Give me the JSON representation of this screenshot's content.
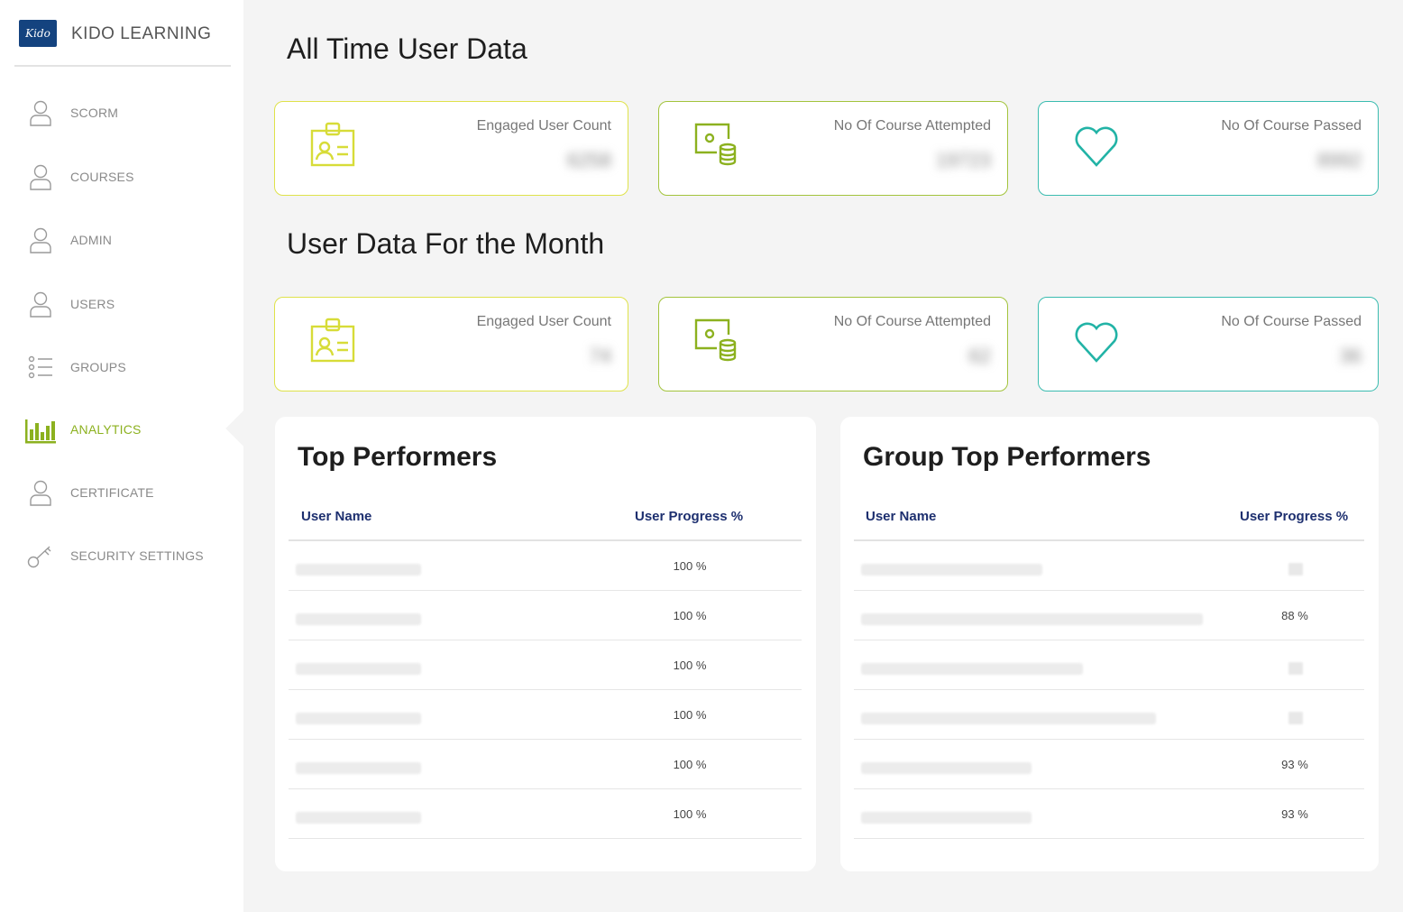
{
  "brand": {
    "logo_text": "Kido",
    "name": "KIDO LEARNING"
  },
  "sidebar": {
    "items": [
      {
        "label": "SCORM",
        "icon": "user-icon"
      },
      {
        "label": "COURSES",
        "icon": "user-icon"
      },
      {
        "label": "ADMIN",
        "icon": "user-icon"
      },
      {
        "label": "USERS",
        "icon": "user-icon"
      },
      {
        "label": "GROUPS",
        "icon": "list-icon"
      },
      {
        "label": "ANALYTICS",
        "icon": "bar-chart-icon",
        "active": true
      },
      {
        "label": "CERTIFICATE",
        "icon": "user-icon"
      },
      {
        "label": "SECURITY SETTINGS",
        "icon": "key-icon"
      }
    ]
  },
  "all_time": {
    "title": "All Time User Data",
    "cards": [
      {
        "label": "Engaged User Count",
        "value": "6258",
        "icon": "id-badge-icon"
      },
      {
        "label": "No Of Course Attempted",
        "value": "19723",
        "icon": "certificate-coins-icon"
      },
      {
        "label": "No Of Course Passed",
        "value": "8992",
        "icon": "heart-icon"
      }
    ]
  },
  "month": {
    "title": "User Data For the Month",
    "cards": [
      {
        "label": "Engaged User Count",
        "value": "74",
        "icon": "id-badge-icon"
      },
      {
        "label": "No Of Course Attempted",
        "value": "62",
        "icon": "certificate-coins-icon"
      },
      {
        "label": "No Of Course Passed",
        "value": "36",
        "icon": "heart-icon"
      }
    ]
  },
  "top_performers": {
    "title": "Top Performers",
    "col_name": "User Name",
    "col_progress": "User Progress %",
    "rows": [
      "100 %",
      "100 %",
      "100 %",
      "100 %",
      "100 %",
      "100 %"
    ]
  },
  "group_top_performers": {
    "title": "Group Top Performers",
    "col_name": "User Name",
    "col_progress": "User Progress %",
    "rows": [
      "",
      "88 %",
      "",
      "",
      "93 %",
      "93 %"
    ]
  },
  "colors": {
    "accent_yellow": "#d7dc38",
    "accent_green": "#8cb11f",
    "accent_teal": "#22b3a6",
    "header_navy": "#1d2f6f",
    "brand_blue": "#14437f"
  }
}
